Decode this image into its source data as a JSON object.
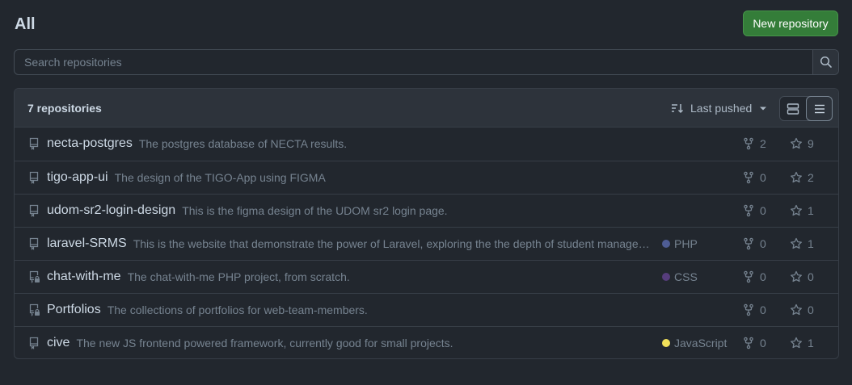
{
  "page": {
    "title": "All",
    "new_repo_label": "New repository"
  },
  "search": {
    "placeholder": "Search repositories"
  },
  "list": {
    "count_label": "7 repositories",
    "sort_label": "Last pushed"
  },
  "colors": {
    "PHP": "#4f5d95",
    "CSS": "#563d7c",
    "JavaScript": "#f1e05a"
  },
  "repos": [
    {
      "name": "necta-postgres",
      "description": "The postgres database of NECTA results.",
      "language": "",
      "forks": "2",
      "stars": "9",
      "private": false
    },
    {
      "name": "tigo-app-ui",
      "description": "The design of the TIGO-App using FIGMA",
      "language": "",
      "forks": "0",
      "stars": "2",
      "private": false
    },
    {
      "name": "udom-sr2-login-design",
      "description": "This is the figma design of the UDOM sr2 login page.",
      "language": "",
      "forks": "0",
      "stars": "1",
      "private": false
    },
    {
      "name": "laravel-SRMS",
      "description": "This is the website that demonstrate the power of Laravel, exploring the the depth of student management system.",
      "language": "PHP",
      "forks": "0",
      "stars": "1",
      "private": false
    },
    {
      "name": "chat-with-me",
      "description": "The chat-with-me PHP project, from scratch.",
      "language": "CSS",
      "forks": "0",
      "stars": "0",
      "private": true
    },
    {
      "name": "Portfolios",
      "description": "The collections of portfolios for web-team-members.",
      "language": "",
      "forks": "0",
      "stars": "0",
      "private": true
    },
    {
      "name": "cive",
      "description": "The new JS frontend powered framework, currently good for small projects.",
      "language": "JavaScript",
      "forks": "0",
      "stars": "1",
      "private": false
    }
  ]
}
